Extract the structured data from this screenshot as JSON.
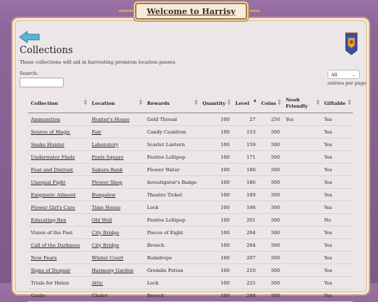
{
  "header": {
    "title": "Welcome to Harrisy"
  },
  "page": {
    "title": "Collections",
    "description": "These collections will aid in harvesting premium location passes."
  },
  "search": {
    "label": "Search:",
    "value": "",
    "placeholder": ""
  },
  "pagination": {
    "selected": "All",
    "label": "entries per page"
  },
  "icons": {
    "back": "back-arrow-icon",
    "location": "heraldic-banner-icon"
  },
  "colors": {
    "accent": "#5ab6d6",
    "frame": "#c9a06a",
    "background": "#8e6699"
  },
  "table": {
    "columns": [
      "Collection",
      "Location",
      "Rewards",
      "Quantity",
      "Level",
      "Coins",
      "Noob Friendly",
      "Giftable"
    ],
    "rows": [
      [
        "Ammunition",
        "Hunter's House",
        "Gold Thread",
        "100",
        "27",
        "250",
        "Yes",
        "Yes"
      ],
      [
        "Source of Magic",
        "Fair",
        "Candy Cauldron",
        "100",
        "153",
        "500",
        "",
        "Yes"
      ],
      [
        "Snake Hunter",
        "Laboratory",
        "Scarlet Lantern",
        "100",
        "159",
        "500",
        "",
        "Yes"
      ],
      [
        "Underwater Finds",
        "Poets Square",
        "Festive Lollipop",
        "100",
        "171",
        "500",
        "",
        "Yes"
      ],
      [
        "Fear and Distrust",
        "Sakura Bank",
        "Flower Water",
        "100",
        "180",
        "500",
        "",
        "Yes"
      ],
      [
        "Unequal Fight",
        "Flower Shop",
        "Investigator's Badge",
        "100",
        "186",
        "500",
        "",
        "Yes"
      ],
      [
        "Enigmatic Ailment",
        "Bungalow",
        "Theatre Ticket",
        "100",
        "189",
        "500",
        "",
        "Yes"
      ],
      [
        "Flower Girl's Care",
        "Time House",
        "Lock",
        "100",
        "198",
        "500",
        "",
        "Yes"
      ],
      [
        "Educating Ben",
        "Old Well",
        "Festive Lollipop",
        "100",
        "201",
        "500",
        "",
        "No"
      ],
      [
        "Vision of the Past",
        "City Bridge",
        "Pieces of Eight",
        "100",
        "204",
        "500",
        "",
        "Yes"
      ],
      [
        "Call of the Darkness",
        "City Bridge",
        "Brooch",
        "100",
        "204",
        "500",
        "",
        "Yes"
      ],
      [
        "New Fears",
        "Winter Court",
        "Raindrops",
        "100",
        "207",
        "500",
        "",
        "Yes"
      ],
      [
        "Signs of Despair",
        "Harmony Garden",
        "Gremlin Potion",
        "100",
        "210",
        "500",
        "",
        "Yes"
      ],
      [
        "Trials for Helen",
        "Attic",
        "Lock",
        "100",
        "225",
        "500",
        "",
        "Yes"
      ],
      [
        "Guide",
        "Chalet",
        "Brooch",
        "100",
        "288",
        "500",
        "",
        "Yes"
      ]
    ],
    "unlinked": [
      "Vision of the Past",
      "Trials for Helen",
      "Guide"
    ]
  }
}
